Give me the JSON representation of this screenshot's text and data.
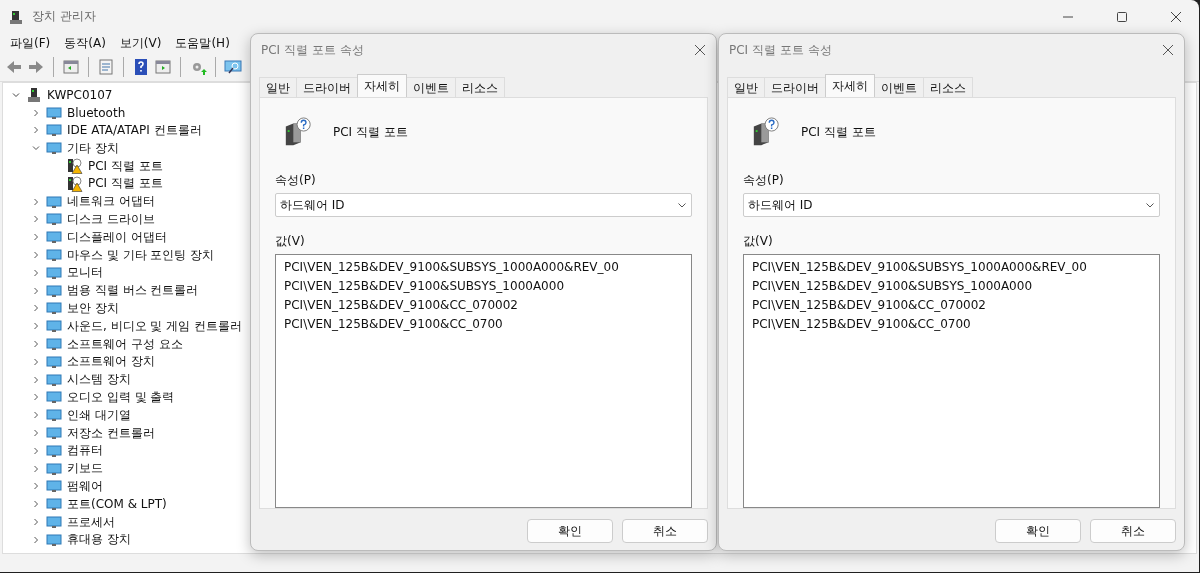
{
  "window": {
    "title": "장치 관리자"
  },
  "menu": [
    "파일(F)",
    "동작(A)",
    "보기(V)",
    "도움말(H)"
  ],
  "tree": [
    {
      "label": "KWPC0107",
      "expanded": true,
      "children": [
        {
          "label": "Bluetooth",
          "expanded": false
        },
        {
          "label": "IDE ATA/ATAPI 컨트롤러",
          "expanded": false
        },
        {
          "label": "기타 장치",
          "expanded": true,
          "children": [
            {
              "label": "PCI 직렬 포트",
              "warning": true
            },
            {
              "label": "PCI 직렬 포트",
              "warning": true
            }
          ]
        },
        {
          "label": "네트워크 어댑터",
          "expanded": false
        },
        {
          "label": "디스크 드라이브",
          "expanded": false
        },
        {
          "label": "디스플레이 어댑터",
          "expanded": false
        },
        {
          "label": "마우스 및 기타 포인팅 장치",
          "expanded": false
        },
        {
          "label": "모니터",
          "expanded": false
        },
        {
          "label": "범용 직렬 버스 컨트롤러",
          "expanded": false
        },
        {
          "label": "보안 장치",
          "expanded": false
        },
        {
          "label": "사운드, 비디오 및 게임 컨트롤러",
          "expanded": false
        },
        {
          "label": "소프트웨어 구성 요소",
          "expanded": false
        },
        {
          "label": "소프트웨어 장치",
          "expanded": false
        },
        {
          "label": "시스템 장치",
          "expanded": false
        },
        {
          "label": "오디오 입력 및 출력",
          "expanded": false
        },
        {
          "label": "인쇄 대기열",
          "expanded": false
        },
        {
          "label": "저장소 컨트롤러",
          "expanded": false
        },
        {
          "label": "컴퓨터",
          "expanded": false
        },
        {
          "label": "키보드",
          "expanded": false
        },
        {
          "label": "펌웨어",
          "expanded": false
        },
        {
          "label": "포트(COM & LPT)",
          "expanded": false
        },
        {
          "label": "프로세서",
          "expanded": false
        },
        {
          "label": "휴대용 장치",
          "expanded": false
        }
      ]
    }
  ],
  "dialogs": [
    {
      "title": "PCI 직렬 포트 속성",
      "tabs": [
        {
          "label": "일반",
          "selected": false
        },
        {
          "label": "드라이버",
          "selected": false
        },
        {
          "label": "자세히",
          "selected": true
        },
        {
          "label": "이벤트",
          "selected": false
        },
        {
          "label": "리소스",
          "selected": false
        }
      ],
      "device_name": "PCI 직렬 포트",
      "property_label": "속성(P)",
      "property_value": "하드웨어 ID",
      "value_label": "값(V)",
      "values": [
        "PCI\\VEN_125B&DEV_9100&SUBSYS_1000A000&REV_00",
        "PCI\\VEN_125B&DEV_9100&SUBSYS_1000A000",
        "PCI\\VEN_125B&DEV_9100&CC_070002",
        "PCI\\VEN_125B&DEV_9100&CC_0700"
      ],
      "buttons": [
        "확인",
        "취소"
      ]
    },
    {
      "title": "PCI 직렬 포트 속성",
      "tabs": [
        {
          "label": "일반",
          "selected": false
        },
        {
          "label": "드라이버",
          "selected": false
        },
        {
          "label": "자세히",
          "selected": true
        },
        {
          "label": "이벤트",
          "selected": false
        },
        {
          "label": "리소스",
          "selected": false
        }
      ],
      "device_name": "PCI 직렬 포트",
      "property_label": "속성(P)",
      "property_value": "하드웨어 ID",
      "value_label": "값(V)",
      "values": [
        "PCI\\VEN_125B&DEV_9100&SUBSYS_1000A000&REV_00",
        "PCI\\VEN_125B&DEV_9100&SUBSYS_1000A000",
        "PCI\\VEN_125B&DEV_9100&CC_070002",
        "PCI\\VEN_125B&DEV_9100&CC_0700"
      ],
      "buttons": [
        "확인",
        "취소"
      ]
    }
  ]
}
